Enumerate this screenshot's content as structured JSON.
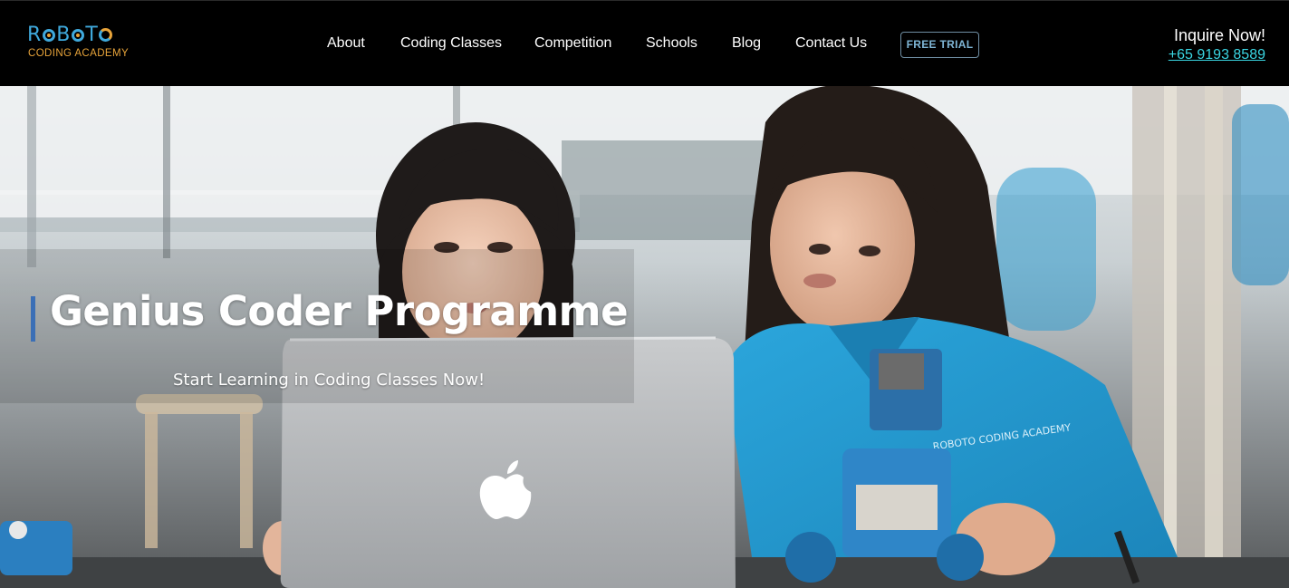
{
  "brand": {
    "name_letters": [
      "R",
      "B",
      "T"
    ],
    "name": "ROBOTO",
    "tagline": "CODING ACADEMY",
    "primary_color": "#3fa9dc",
    "accent_color": "#e8a43a"
  },
  "nav": {
    "items": [
      {
        "label": "About"
      },
      {
        "label": "Coding Classes"
      },
      {
        "label": "Competition"
      },
      {
        "label": "Schools"
      },
      {
        "label": "Blog"
      },
      {
        "label": "Contact Us"
      }
    ],
    "cta_label": "FREE TRIAL"
  },
  "inquire": {
    "label": "Inquire Now!",
    "phone": "+65 9193 8589",
    "phone_color": "#3ad6e3"
  },
  "hero": {
    "title": "Genius Coder Programme",
    "subtitle": "Start Learning in Coding Classes Now!",
    "accent_bar_color": "#3b6fb6",
    "shirt_print": "ROBOTO CODING ACADEMY"
  }
}
